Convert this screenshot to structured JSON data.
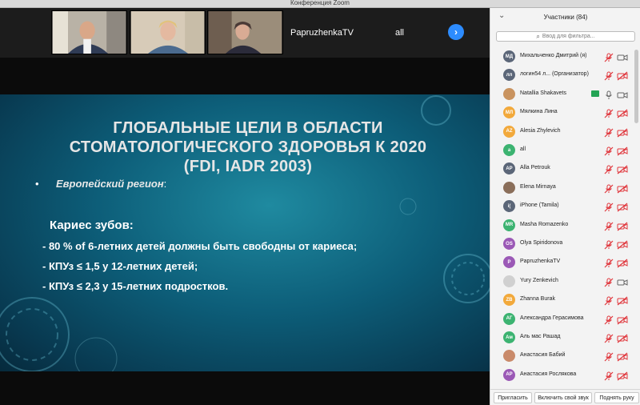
{
  "window": {
    "title": "Конференция Zoom"
  },
  "video_strip": {
    "tiles": [
      {
        "name": "PapruzhenkaTV"
      },
      {
        "name": "all"
      }
    ]
  },
  "slide": {
    "title_lines": [
      "ГЛОБАЛЬНЫЕ ЦЕЛИ В ОБЛАСТИ",
      "СТОМАТОЛОГИЧЕСКОГО ЗДОРОВЬЯ К 2020",
      "(FDI, IADR 2003)"
    ],
    "bullet": "•",
    "region": "Европейский регион",
    "region_suffix": ":",
    "caries_heading": "Кариес зубов:",
    "lines": [
      "- 80 % of 6-летних детей должны быть свободны от кариеса;",
      "- КПУз ≤ 1,5 у 12-летних детей;",
      "- КПУз ≤ 2,3 у 15-летних подростков."
    ]
  },
  "participants_panel": {
    "title": "Участники (84)",
    "filter_placeholder": "Ввод для фильтра...",
    "participants": [
      {
        "initials": "МД",
        "name": "Михальченко Дмитрий (я)",
        "color": "#5b6678",
        "mic": "muted",
        "cam": "on"
      },
      {
        "initials": "лл",
        "name": "логин54 л...    (Организатор)",
        "color": "#5b6678",
        "mic": "muted",
        "cam": "off"
      },
      {
        "initials": "",
        "name": "Natallia Shakavets",
        "color": "#c9935f",
        "mic": "on",
        "cam": "on",
        "sharing": true
      },
      {
        "initials": "МЛ",
        "name": "Мялкина Лина",
        "color": "#f2a93b",
        "mic": "muted",
        "cam": "off"
      },
      {
        "initials": "AZ",
        "name": "Alesia Zhylevich",
        "color": "#f2a93b",
        "mic": "muted",
        "cam": "off"
      },
      {
        "initials": "a",
        "name": "all",
        "color": "#3cb371",
        "mic": "muted",
        "cam": "off"
      },
      {
        "initials": "AP",
        "name": "Alla Petrouk",
        "color": "#5b6678",
        "mic": "muted",
        "cam": "off"
      },
      {
        "initials": "",
        "name": "Elena Mirnaya",
        "color": "#8a6e5a",
        "mic": "muted",
        "cam": "off"
      },
      {
        "initials": "i(",
        "name": "iPhone (Tamila)",
        "color": "#5b6678",
        "mic": "muted",
        "cam": "off"
      },
      {
        "initials": "MR",
        "name": "Masha Romazenko",
        "color": "#3cb371",
        "mic": "muted",
        "cam": "off"
      },
      {
        "initials": "OS",
        "name": "Olya Spiridonova",
        "color": "#9b59b6",
        "mic": "muted",
        "cam": "off"
      },
      {
        "initials": "P",
        "name": "PapruzhenkaTV",
        "color": "#9b59b6",
        "mic": "muted",
        "cam": "off"
      },
      {
        "initials": "",
        "name": "Yury Zenkevich",
        "color": "#d0d0d0",
        "mic": "muted",
        "cam": "on"
      },
      {
        "initials": "ZB",
        "name": "Zhanna Burak",
        "color": "#f2a93b",
        "mic": "muted",
        "cam": "off"
      },
      {
        "initials": "АГ",
        "name": "Александра Герасимова",
        "color": "#3cb371",
        "mic": "muted",
        "cam": "off"
      },
      {
        "initials": "Ам",
        "name": "Аль мас Рашад",
        "color": "#3cb371",
        "mic": "muted",
        "cam": "off"
      },
      {
        "initials": "",
        "name": "Анастасия Бабий",
        "color": "#c98a6a",
        "mic": "muted",
        "cam": "off"
      },
      {
        "initials": "АР",
        "name": "Анастасия Рослякова",
        "color": "#9b59b6",
        "mic": "muted",
        "cam": "off"
      }
    ],
    "footer": {
      "invite": "Пригласить",
      "unmute": "Включить свой звук",
      "raise_hand": "Поднять руку"
    }
  },
  "icons": {
    "collapse": "chevron-down-icon",
    "search": "search-icon",
    "next": "chevron-right-icon",
    "mic_muted": "mic-muted-icon",
    "mic_on": "mic-icon",
    "cam_off": "camera-off-icon",
    "cam_on": "camera-icon",
    "share": "share-screen-icon"
  },
  "colors": {
    "accent": "#2d8cff",
    "muted_red": "#e0383e",
    "share_green": "#23a455"
  }
}
